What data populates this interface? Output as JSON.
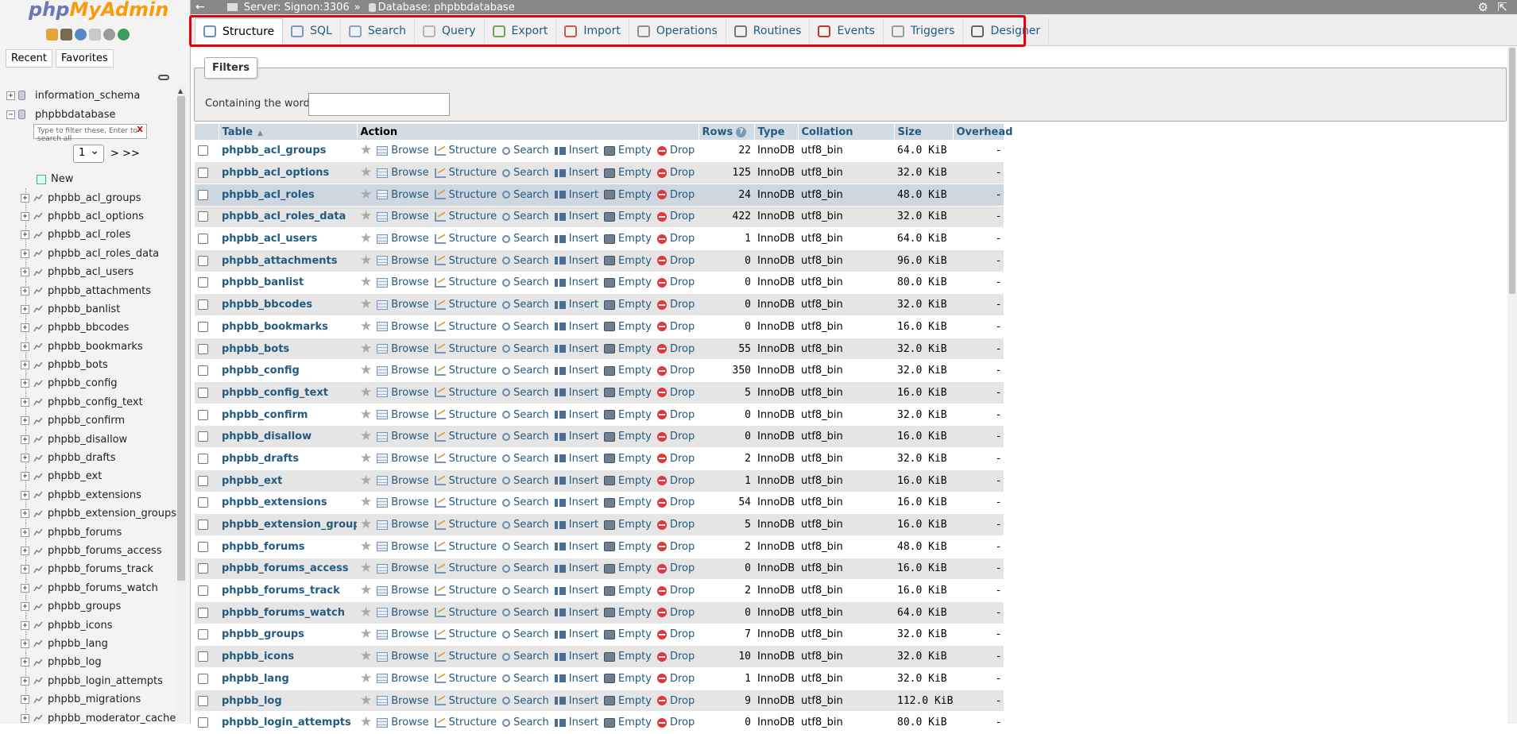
{
  "logo": {
    "php": "php",
    "myadmin": "MyAdmin"
  },
  "nav_tabs": {
    "recent": "Recent",
    "favorites": "Favorites"
  },
  "databases": [
    "information_schema",
    "phpbbdatabase"
  ],
  "nav_filter": {
    "placeholder": "Type to filter these, Enter to search all",
    "clear": "X"
  },
  "pager": {
    "selected": "1",
    "next": "> >>"
  },
  "new_label": "New",
  "nav_tables": [
    "phpbb_acl_groups",
    "phpbb_acl_options",
    "phpbb_acl_roles",
    "phpbb_acl_roles_data",
    "phpbb_acl_users",
    "phpbb_attachments",
    "phpbb_banlist",
    "phpbb_bbcodes",
    "phpbb_bookmarks",
    "phpbb_bots",
    "phpbb_config",
    "phpbb_config_text",
    "phpbb_confirm",
    "phpbb_disallow",
    "phpbb_drafts",
    "phpbb_ext",
    "phpbb_extensions",
    "phpbb_extension_groups",
    "phpbb_forums",
    "phpbb_forums_access",
    "phpbb_forums_track",
    "phpbb_forums_watch",
    "phpbb_groups",
    "phpbb_icons",
    "phpbb_lang",
    "phpbb_log",
    "phpbb_login_attempts",
    "phpbb_migrations",
    "phpbb_moderator_cache"
  ],
  "breadcrumb": {
    "server": "Server: Signon:3306",
    "separator": "»",
    "database": "Database: phpbbdatabase"
  },
  "tabs": [
    {
      "label": "Structure",
      "icon": "structure-icon",
      "color": "#6f8fb5"
    },
    {
      "label": "SQL",
      "icon": "sql-icon",
      "color": "#7a98c0"
    },
    {
      "label": "Search",
      "icon": "search-icon",
      "color": "#8aa2be"
    },
    {
      "label": "Query",
      "icon": "query-icon",
      "color": "#b4b4b4"
    },
    {
      "label": "Export",
      "icon": "export-icon",
      "color": "#6aa55b"
    },
    {
      "label": "Import",
      "icon": "import-icon",
      "color": "#c9594e"
    },
    {
      "label": "Operations",
      "icon": "wrench-icon",
      "color": "#8d8d8d"
    },
    {
      "label": "Routines",
      "icon": "routines-icon",
      "color": "#777777"
    },
    {
      "label": "Events",
      "icon": "clock-icon",
      "color": "#c0392b"
    },
    {
      "label": "Triggers",
      "icon": "triggers-icon",
      "color": "#999999"
    },
    {
      "label": "Designer",
      "icon": "designer-icon",
      "color": "#666666"
    }
  ],
  "filters": {
    "legend": "Filters",
    "label": "Containing the word:",
    "value": ""
  },
  "table_headers": {
    "table": "Table",
    "action": "Action",
    "rows": "Rows",
    "help": "?",
    "type": "Type",
    "collation": "Collation",
    "size": "Size",
    "overhead": "Overhead"
  },
  "actions": {
    "browse": "Browse",
    "structure": "Structure",
    "search": "Search",
    "insert": "Insert",
    "empty": "Empty",
    "drop": "Drop"
  },
  "rows": [
    {
      "name": "phpbb_acl_groups",
      "rows": "22",
      "type": "InnoDB",
      "collation": "utf8_bin",
      "size": "64.0 KiB",
      "overhead": "-"
    },
    {
      "name": "phpbb_acl_options",
      "rows": "125",
      "type": "InnoDB",
      "collation": "utf8_bin",
      "size": "32.0 KiB",
      "overhead": "-"
    },
    {
      "name": "phpbb_acl_roles",
      "rows": "24",
      "type": "InnoDB",
      "collation": "utf8_bin",
      "size": "48.0 KiB",
      "overhead": "-"
    },
    {
      "name": "phpbb_acl_roles_data",
      "rows": "422",
      "type": "InnoDB",
      "collation": "utf8_bin",
      "size": "32.0 KiB",
      "overhead": "-"
    },
    {
      "name": "phpbb_acl_users",
      "rows": "1",
      "type": "InnoDB",
      "collation": "utf8_bin",
      "size": "64.0 KiB",
      "overhead": "-"
    },
    {
      "name": "phpbb_attachments",
      "rows": "0",
      "type": "InnoDB",
      "collation": "utf8_bin",
      "size": "96.0 KiB",
      "overhead": "-"
    },
    {
      "name": "phpbb_banlist",
      "rows": "0",
      "type": "InnoDB",
      "collation": "utf8_bin",
      "size": "80.0 KiB",
      "overhead": "-"
    },
    {
      "name": "phpbb_bbcodes",
      "rows": "0",
      "type": "InnoDB",
      "collation": "utf8_bin",
      "size": "32.0 KiB",
      "overhead": "-"
    },
    {
      "name": "phpbb_bookmarks",
      "rows": "0",
      "type": "InnoDB",
      "collation": "utf8_bin",
      "size": "16.0 KiB",
      "overhead": "-"
    },
    {
      "name": "phpbb_bots",
      "rows": "55",
      "type": "InnoDB",
      "collation": "utf8_bin",
      "size": "32.0 KiB",
      "overhead": "-"
    },
    {
      "name": "phpbb_config",
      "rows": "350",
      "type": "InnoDB",
      "collation": "utf8_bin",
      "size": "32.0 KiB",
      "overhead": "-"
    },
    {
      "name": "phpbb_config_text",
      "rows": "5",
      "type": "InnoDB",
      "collation": "utf8_bin",
      "size": "16.0 KiB",
      "overhead": "-"
    },
    {
      "name": "phpbb_confirm",
      "rows": "0",
      "type": "InnoDB",
      "collation": "utf8_bin",
      "size": "32.0 KiB",
      "overhead": "-"
    },
    {
      "name": "phpbb_disallow",
      "rows": "0",
      "type": "InnoDB",
      "collation": "utf8_bin",
      "size": "16.0 KiB",
      "overhead": "-"
    },
    {
      "name": "phpbb_drafts",
      "rows": "2",
      "type": "InnoDB",
      "collation": "utf8_bin",
      "size": "32.0 KiB",
      "overhead": "-"
    },
    {
      "name": "phpbb_ext",
      "rows": "1",
      "type": "InnoDB",
      "collation": "utf8_bin",
      "size": "16.0 KiB",
      "overhead": "-"
    },
    {
      "name": "phpbb_extensions",
      "rows": "54",
      "type": "InnoDB",
      "collation": "utf8_bin",
      "size": "16.0 KiB",
      "overhead": "-"
    },
    {
      "name": "phpbb_extension_groups",
      "rows": "5",
      "type": "InnoDB",
      "collation": "utf8_bin",
      "size": "16.0 KiB",
      "overhead": "-"
    },
    {
      "name": "phpbb_forums",
      "rows": "2",
      "type": "InnoDB",
      "collation": "utf8_bin",
      "size": "48.0 KiB",
      "overhead": "-"
    },
    {
      "name": "phpbb_forums_access",
      "rows": "0",
      "type": "InnoDB",
      "collation": "utf8_bin",
      "size": "16.0 KiB",
      "overhead": "-"
    },
    {
      "name": "phpbb_forums_track",
      "rows": "2",
      "type": "InnoDB",
      "collation": "utf8_bin",
      "size": "16.0 KiB",
      "overhead": "-"
    },
    {
      "name": "phpbb_forums_watch",
      "rows": "0",
      "type": "InnoDB",
      "collation": "utf8_bin",
      "size": "64.0 KiB",
      "overhead": "-"
    },
    {
      "name": "phpbb_groups",
      "rows": "7",
      "type": "InnoDB",
      "collation": "utf8_bin",
      "size": "32.0 KiB",
      "overhead": "-"
    },
    {
      "name": "phpbb_icons",
      "rows": "10",
      "type": "InnoDB",
      "collation": "utf8_bin",
      "size": "32.0 KiB",
      "overhead": "-"
    },
    {
      "name": "phpbb_lang",
      "rows": "1",
      "type": "InnoDB",
      "collation": "utf8_bin",
      "size": "32.0 KiB",
      "overhead": "-"
    },
    {
      "name": "phpbb_log",
      "rows": "9",
      "type": "InnoDB",
      "collation": "utf8_bin",
      "size": "112.0 KiB",
      "overhead": "-"
    },
    {
      "name": "phpbb_login_attempts",
      "rows": "0",
      "type": "InnoDB",
      "collation": "utf8_bin",
      "size": "80.0 KiB",
      "overhead": "-"
    }
  ],
  "colors": {
    "link": "#235a81",
    "highlight_border": "#e6000a",
    "header_bg": "#d3dce3",
    "logo_blue": "#6c78af",
    "logo_orange": "#f89c0e"
  }
}
